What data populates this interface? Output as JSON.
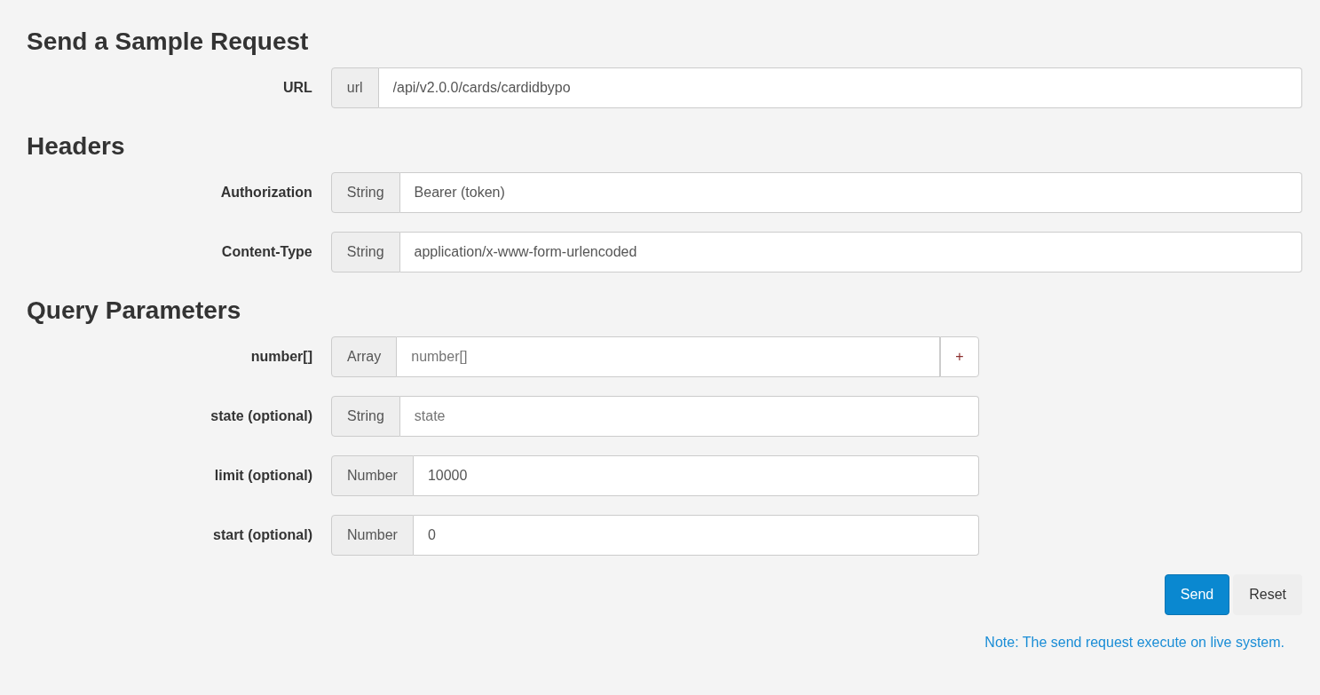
{
  "sections": [
    {
      "title": "Send a Sample Request",
      "kind": "wide",
      "fields": [
        {
          "label": "URL",
          "addon": "url",
          "value": "/api/v2.0.0/cards/cardidbypo"
        }
      ]
    },
    {
      "title": "Headers",
      "kind": "wide",
      "fields": [
        {
          "label": "Authorization",
          "addon": "String",
          "value": "Bearer (token)"
        },
        {
          "label": "Content-Type",
          "addon": "String",
          "value": "application/x-www-form-urlencoded"
        }
      ]
    },
    {
      "title": "Query Parameters",
      "kind": "narrow",
      "fields": [
        {
          "label": "number[]",
          "addon": "Array",
          "placeholder": "number[]",
          "add_button": "+"
        },
        {
          "label": "state (optional)",
          "addon": "String",
          "placeholder": "state"
        },
        {
          "label": "limit (optional)",
          "addon": "Number",
          "value": "10000"
        },
        {
          "label": "start (optional)",
          "addon": "Number",
          "value": "0"
        }
      ]
    }
  ],
  "buttons": [
    {
      "label": "Send",
      "kind": "primary"
    },
    {
      "label": "Reset",
      "kind": "default"
    }
  ],
  "note": "Note: The send request execute on live system."
}
